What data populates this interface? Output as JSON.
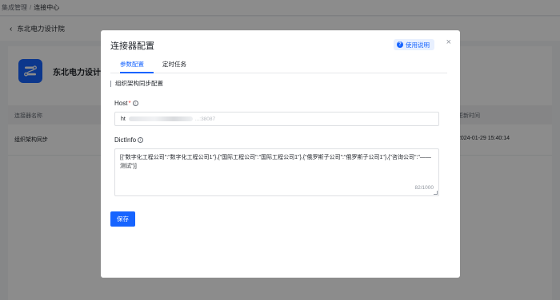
{
  "breadcrumb": {
    "parent": "集成管理",
    "separator": "/",
    "current": "连接中心"
  },
  "subheader": {
    "back_icon": "chevron-left-icon",
    "title": "东北电力设计院"
  },
  "app": {
    "name": "东北电力设计院",
    "icon": "connector-app-icon"
  },
  "table": {
    "columns": [
      "连接器名称",
      "更新时间"
    ],
    "rows": [
      {
        "name": "组织架构同步",
        "time": "2024-01-29 15:40:14"
      }
    ]
  },
  "modal": {
    "title": "连接器配置",
    "help_label": "使用说明",
    "close_icon": "close-icon",
    "tabs": [
      {
        "label": "参数配置",
        "active": true
      },
      {
        "label": "定时任务",
        "active": false
      }
    ],
    "section_title": "组织架构同步配置",
    "fields": {
      "host": {
        "label": "Host",
        "required_mark": "*",
        "value_prefix": "ht",
        "value_suffix": "...:38087"
      },
      "dictinfo": {
        "label": "DictInfo",
        "value": "[{\"数字化工程公司\":\"数字化工程公司1\"},{\"国际工程公司\":\"国际工程公司1\"},{\"俄罗斯子公司\":\"俄罗斯子公司1\"},{\"咨询公司\":\"——测试\"}]",
        "counter": "82/1000"
      }
    },
    "save_label": "保存"
  },
  "colors": {
    "primary": "#1664ff",
    "required": "#f54a45",
    "overlay": "rgba(0,0,0,0.45)"
  }
}
